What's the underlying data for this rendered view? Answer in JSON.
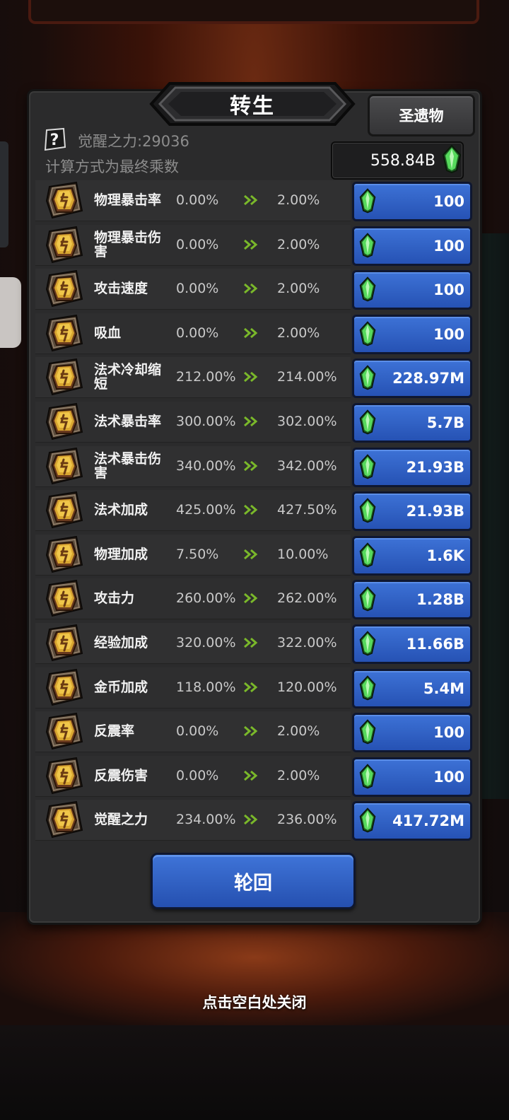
{
  "header": {
    "title": "转生",
    "relic_button": "圣遗物",
    "help_icon": "question-mark-icon",
    "awaken_power": "觉醒之力:29036",
    "calc_note": "计算方式为最终乘数",
    "currency": "558.84B"
  },
  "colors": {
    "panel": "#2b2b2c",
    "button_blue": "#3063c8",
    "gem_green": "#4fd35a",
    "rune_gold": "#d8a530"
  },
  "rows": [
    {
      "name": "物理暴击率",
      "from": "0.00%",
      "to": "2.00%",
      "cost": "100"
    },
    {
      "name": "物理暴击伤害",
      "from": "0.00%",
      "to": "2.00%",
      "cost": "100"
    },
    {
      "name": "攻击速度",
      "from": "0.00%",
      "to": "2.00%",
      "cost": "100"
    },
    {
      "name": "吸血",
      "from": "0.00%",
      "to": "2.00%",
      "cost": "100"
    },
    {
      "name": "法术冷却缩短",
      "from": "212.00%",
      "to": "214.00%",
      "cost": "228.97M"
    },
    {
      "name": "法术暴击率",
      "from": "300.00%",
      "to": "302.00%",
      "cost": "5.7B"
    },
    {
      "name": "法术暴击伤害",
      "from": "340.00%",
      "to": "342.00%",
      "cost": "21.93B"
    },
    {
      "name": "法术加成",
      "from": "425.00%",
      "to": "427.50%",
      "cost": "21.93B"
    },
    {
      "name": "物理加成",
      "from": "7.50%",
      "to": "10.00%",
      "cost": "1.6K"
    },
    {
      "name": "攻击力",
      "from": "260.00%",
      "to": "262.00%",
      "cost": "1.28B"
    },
    {
      "name": "经验加成",
      "from": "320.00%",
      "to": "322.00%",
      "cost": "11.66B"
    },
    {
      "name": "金币加成",
      "from": "118.00%",
      "to": "120.00%",
      "cost": "5.4M"
    },
    {
      "name": "反震率",
      "from": "0.00%",
      "to": "2.00%",
      "cost": "100"
    },
    {
      "name": "反震伤害",
      "from": "0.00%",
      "to": "2.00%",
      "cost": "100"
    },
    {
      "name": "觉醒之力",
      "from": "234.00%",
      "to": "236.00%",
      "cost": "417.72M"
    }
  ],
  "footer": {
    "reincarnate_button": "轮回",
    "close_hint": "点击空白处关闭"
  }
}
